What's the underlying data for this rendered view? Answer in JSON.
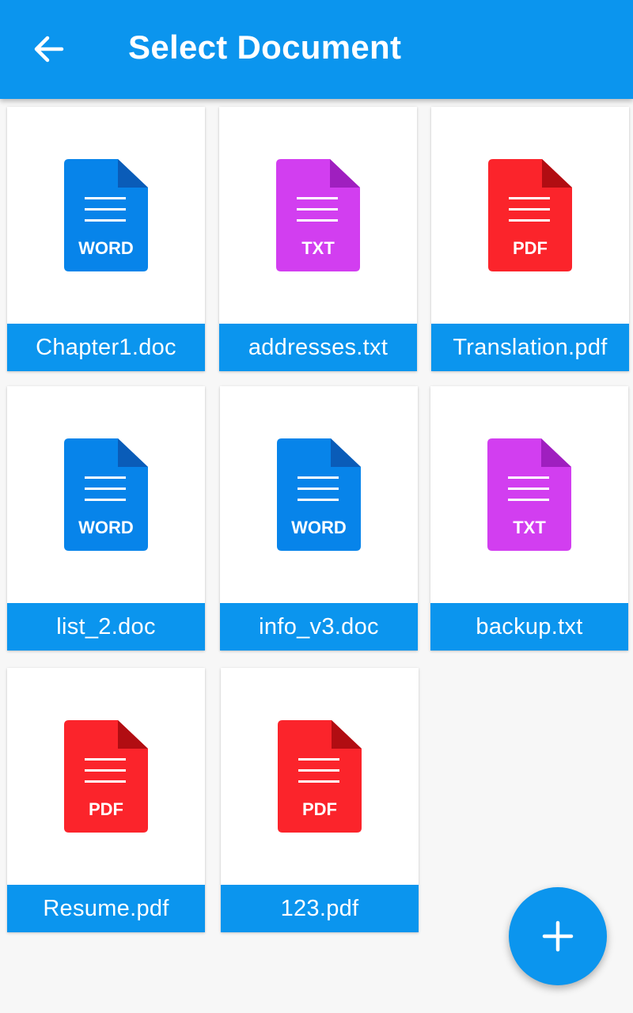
{
  "app_bar": {
    "title": "Select Document",
    "back_icon": "arrow-left-icon",
    "background_color": "#0b95ee"
  },
  "file_types": {
    "word": {
      "label": "WORD",
      "color": "#0784ea",
      "fold_color": "#0a5cb8",
      "icon": "word-file-icon"
    },
    "txt": {
      "label": "TXT",
      "color": "#d23ef0",
      "fold_color": "#9f1fbf",
      "icon": "txt-file-icon"
    },
    "pdf": {
      "label": "PDF",
      "color": "#fb242b",
      "fold_color": "#b10d12",
      "icon": "pdf-file-icon"
    }
  },
  "files": [
    {
      "name": "Chapter1.doc",
      "type": "word"
    },
    {
      "name": "addresses.txt",
      "type": "txt"
    },
    {
      "name": "Translation.pdf",
      "type": "pdf"
    },
    {
      "name": "list_2.doc",
      "type": "word"
    },
    {
      "name": "info_v3.doc",
      "type": "word"
    },
    {
      "name": "backup.txt",
      "type": "txt"
    },
    {
      "name": "Resume.pdf",
      "type": "pdf"
    },
    {
      "name": "123.pdf",
      "type": "pdf"
    }
  ],
  "fab": {
    "icon": "plus-icon"
  }
}
